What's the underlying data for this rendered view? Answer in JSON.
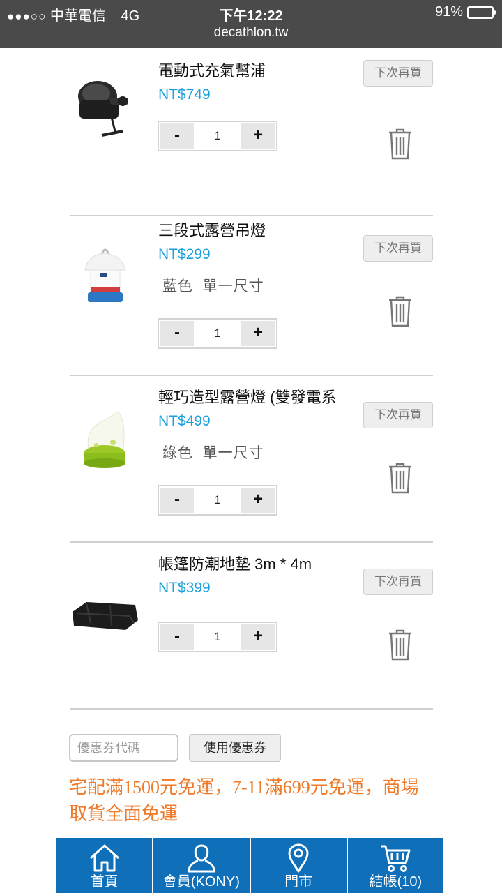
{
  "status_bar": {
    "signal": "●●●○○",
    "carrier": "中華電信",
    "network": "4G",
    "time": "下午12:22",
    "battery": "91%",
    "battery_level": 0.91,
    "url": "decathlon.tw"
  },
  "cart": {
    "later_label": "下次再買",
    "minus_label": "-",
    "plus_label": "+",
    "items": [
      {
        "name": "電動式充氣幫浦",
        "price": "NT$749",
        "variant": "",
        "quantity": "1"
      },
      {
        "name": "三段式露營吊燈",
        "price": "NT$299",
        "variant": "藍色  單一尺寸",
        "quantity": "1"
      },
      {
        "name": "輕巧造型露營燈 (雙發電系",
        "price": "NT$499",
        "variant": "綠色  單一尺寸",
        "quantity": "1"
      },
      {
        "name": "帳篷防潮地墊 3m * 4m",
        "price": "NT$399",
        "variant": "",
        "quantity": "1"
      }
    ]
  },
  "coupon": {
    "placeholder": "優惠券代碼",
    "apply_label": "使用優惠券"
  },
  "shipping_notice": "宅配滿1500元免運，7-11滿699元免運，商場取貨全面免運",
  "colors": {
    "price": "#1aa0dc",
    "notice": "#ee7a2a",
    "nav_bg": "#0f6fb8",
    "status_bg": "#4a4a4a"
  },
  "bottom_nav": [
    {
      "label": "首頁",
      "icon": "home-icon"
    },
    {
      "label": "會員(KONY)",
      "icon": "user-icon"
    },
    {
      "label": "門市",
      "icon": "map-pin-icon"
    },
    {
      "label": "結帳(10)",
      "icon": "cart-icon"
    }
  ]
}
